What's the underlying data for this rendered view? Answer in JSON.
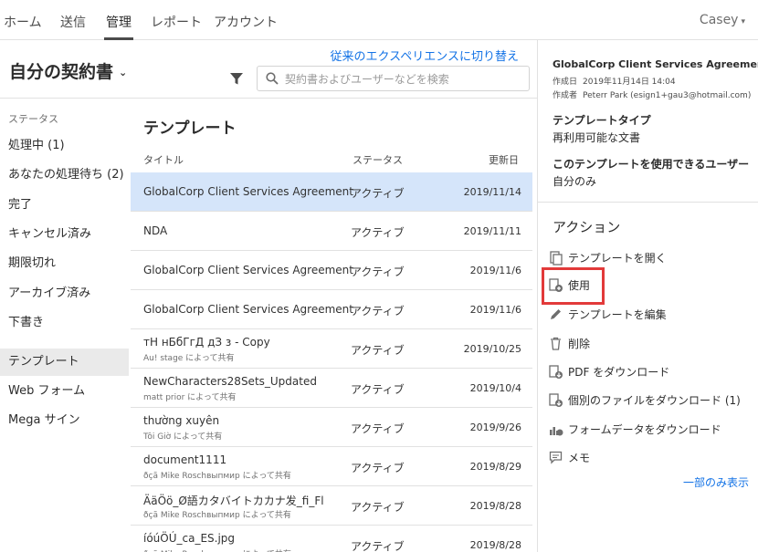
{
  "nav": {
    "tabs": [
      "ホーム",
      "送信",
      "管理",
      "レポート",
      "アカウント"
    ],
    "active": "管理",
    "user": "Casey"
  },
  "header": {
    "title": "自分の契約書",
    "switch_link": "従来のエクスペリエンスに切り替え",
    "search_placeholder": "契約書およびユーザーなどを検索"
  },
  "sidebar": {
    "section_label": "ステータス",
    "items": [
      {
        "label": "処理中 (1)"
      },
      {
        "label": "あなたの処理待ち (2)"
      },
      {
        "label": "完了"
      },
      {
        "label": "キャンセル済み"
      },
      {
        "label": "期限切れ"
      },
      {
        "label": "アーカイブ済み"
      },
      {
        "label": "下書き"
      },
      {
        "label": "テンプレート"
      },
      {
        "label": "Web フォーム"
      },
      {
        "label": "Mega サイン"
      }
    ],
    "active": "テンプレート"
  },
  "list": {
    "title": "テンプレート",
    "columns": {
      "title": "タイトル",
      "status": "ステータス",
      "updated": "更新日"
    },
    "rows": [
      {
        "name": "GlobalCorp Client Services Agreement",
        "sub": "",
        "status": "アクティブ",
        "date": "2019/11/14",
        "selected": true
      },
      {
        "name": "NDA",
        "sub": "",
        "status": "アクティブ",
        "date": "2019/11/11",
        "selected": false
      },
      {
        "name": "GlobalCorp Client Services Agreement",
        "sub": "",
        "status": "アクティブ",
        "date": "2019/11/6",
        "selected": false
      },
      {
        "name": "GlobalCorp Client Services Agreement",
        "sub": "",
        "status": "アクティブ",
        "date": "2019/11/6",
        "selected": false
      },
      {
        "name": "тН нБбГгД дЗ з - Copy",
        "sub": "Au! stage によって共有",
        "status": "アクティブ",
        "date": "2019/10/25",
        "selected": false
      },
      {
        "name": "NewCharacters28Sets_Updated",
        "sub": "matt prior によって共有",
        "status": "アクティブ",
        "date": "2019/10/4",
        "selected": false
      },
      {
        "name": "thường xuyên",
        "sub": "Tôi Giờ によって共有",
        "status": "アクティブ",
        "date": "2019/9/26",
        "selected": false
      },
      {
        "name": "document1111",
        "sub": "ðçã Mike Roschвыпмир によって共有",
        "status": "アクティブ",
        "date": "2019/8/29",
        "selected": false
      },
      {
        "name": "ÄäÖö_Ø語カタバイトカカナ发_fi_Fl",
        "sub": "ðçã Mike Roschвыпмир によって共有",
        "status": "アクティブ",
        "date": "2019/8/28",
        "selected": false
      },
      {
        "name": "íóúÖÚ_ca_ES.jpg",
        "sub": "ðçã Mike Roschвыпмир によって共有",
        "status": "アクティブ",
        "date": "2019/8/28",
        "selected": false
      }
    ]
  },
  "panel": {
    "doc_title": "GlobalCorp Client Services Agreement",
    "created_label": "作成日",
    "created_value": "2019年11月14日 14:04",
    "creator_label": "作成者",
    "creator_value": "Peterr Park (esign1+gau3@hotmail.com)",
    "type_label": "テンプレートタイプ",
    "type_value": "再利用可能な文書",
    "users_label": "このテンプレートを使用できるユーザー",
    "users_value": "自分のみ",
    "actions_heading": "アクション",
    "actions": [
      {
        "label": "テンプレートを開く",
        "icon": "open-doc-icon"
      },
      {
        "label": "使用",
        "icon": "use-doc-icon"
      },
      {
        "label": "テンプレートを編集",
        "icon": "pencil-icon"
      },
      {
        "label": "削除",
        "icon": "trash-icon"
      },
      {
        "label": "PDF をダウンロード",
        "icon": "pdf-download-icon"
      },
      {
        "label": "個別のファイルをダウンロード (1)",
        "icon": "files-download-icon"
      },
      {
        "label": "フォームデータをダウンロード",
        "icon": "form-data-icon"
      },
      {
        "label": "メモ",
        "icon": "note-icon"
      }
    ],
    "highlight_color": "#e23a3a",
    "partial_link": "一部のみ表示"
  },
  "colors": {
    "accent": "#1473e6",
    "selected_row": "#d5e5fa"
  }
}
